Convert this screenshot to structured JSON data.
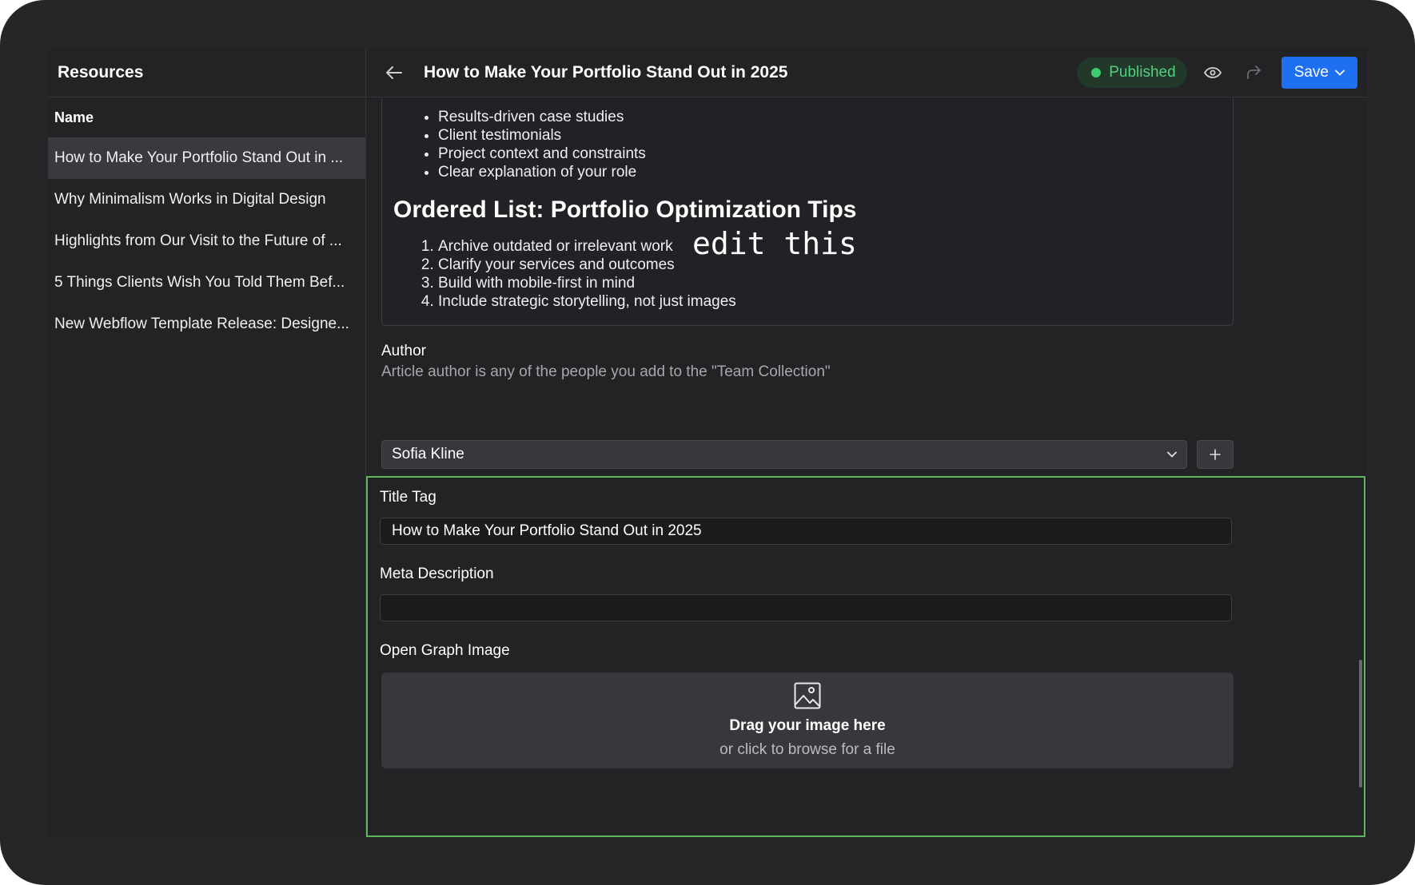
{
  "sidebar": {
    "title": "Resources",
    "column_header": "Name",
    "items": [
      {
        "label": "How to Make Your Portfolio Stand Out in ..."
      },
      {
        "label": "Why Minimalism Works in Digital Design"
      },
      {
        "label": "Highlights from Our Visit to the Future of ..."
      },
      {
        "label": "5 Things Clients Wish You Told Them Bef..."
      },
      {
        "label": "New Webflow Template Release: Designe..."
      }
    ]
  },
  "header": {
    "title": "How to Make Your Portfolio Stand Out in 2025",
    "status": "Published",
    "save_label": "Save"
  },
  "editor": {
    "bullets": [
      "Results-driven case studies",
      "Client testimonials",
      "Project context and constraints",
      "Clear explanation of your role"
    ],
    "ordered_heading": "Ordered List: Portfolio Optimization Tips",
    "ordered": [
      "Archive outdated or irrelevant work",
      "Clarify your services and outcomes",
      "Build with mobile-first in mind",
      "Include strategic storytelling, not just images"
    ],
    "annotation": "edit this"
  },
  "author": {
    "label": "Author",
    "help": "Article author is any of the people you add to the \"Team Collection\"",
    "value": "Sofia Kline"
  },
  "seo": {
    "title_tag_label": "Title Tag",
    "title_tag_value": "How to Make Your Portfolio Stand Out in 2025",
    "meta_label": "Meta Description",
    "meta_value": "",
    "og_label": "Open Graph Image",
    "drop_title": "Drag your image here",
    "drop_sub": "or click to browse for a file"
  },
  "colors": {
    "accent": "#1f6ff2",
    "status_green": "#3ccc6f",
    "highlight_border": "#5fb65c"
  }
}
